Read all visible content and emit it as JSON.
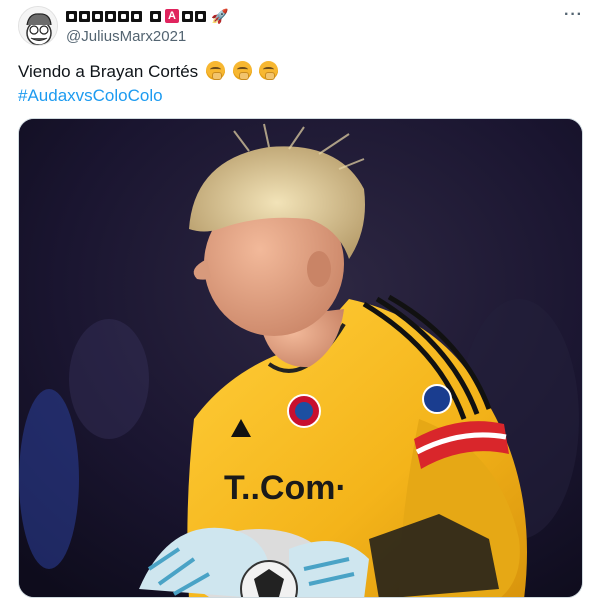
{
  "tweet": {
    "display_name_visible_letters": [
      "M",
      "A",
      "R",
      "X"
    ],
    "handle": "@JuliusMarx2021",
    "more_icon": "···",
    "text": "Viendo a Brayan Cortés",
    "emojis": [
      "face-with-hand-over-mouth-emoji",
      "face-with-hand-over-mouth-emoji",
      "face-with-hand-over-mouth-emoji"
    ],
    "hashtag": "#AudaxvsColoColo",
    "media": {
      "shirt_text": "T..Com·",
      "icon": "goalkeeper-photo"
    }
  },
  "colors": {
    "hashtag": "#1d9bf0",
    "handle": "#536471",
    "jersey": "#f6b81c",
    "armband": "#d9262b"
  }
}
